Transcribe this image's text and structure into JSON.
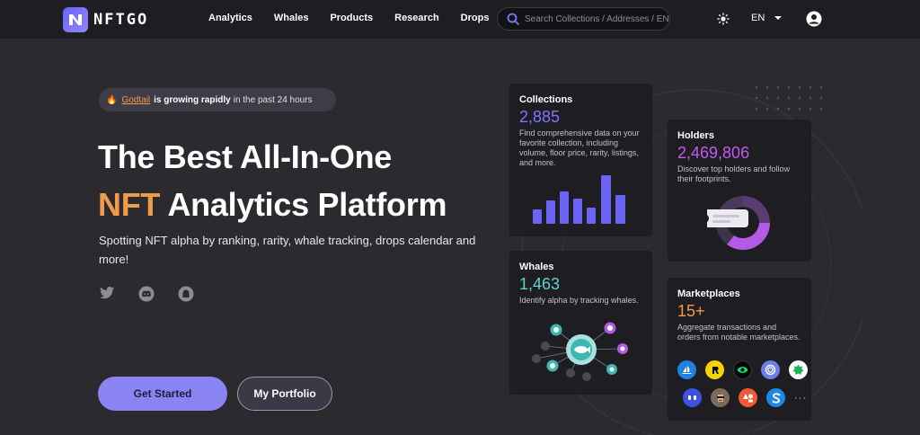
{
  "nav": {
    "logo_text": "NFTGO",
    "links": [
      "Analytics",
      "Whales",
      "Products",
      "Research",
      "Drops"
    ],
    "search_placeholder": "Search Collections / Addresses / ENS",
    "language": "EN"
  },
  "hero": {
    "badge": {
      "collection": "Godtail",
      "bold_text": "is growing rapidly",
      "rest_text": "in the past 24 hours"
    },
    "title_line1": "The Best All-In-One",
    "title_accent": "NFT",
    "title_line2_rest": " Analytics Platform",
    "subtitle": "Spotting NFT alpha by ranking, rarity, whale tracking, drops calendar and more!",
    "primary_button": "Get Started",
    "secondary_button": "My Portfolio",
    "social_icons": [
      "twitter-icon",
      "discord-icon",
      "ghost-icon"
    ]
  },
  "cards": {
    "collections": {
      "title": "Collections",
      "value": "2,885",
      "desc": "Find comprehensive data on your favorite collection, including volume, floor price, rarity, listings, and more."
    },
    "holders": {
      "title": "Holders",
      "value": "2,469,806",
      "desc": "Discover top holders and follow their footprints."
    },
    "whales": {
      "title": "Whales",
      "value": "1,463",
      "desc": "Identify alpha by tracking whales."
    },
    "marketplaces": {
      "title": "Marketplaces",
      "value": "15+",
      "desc": "Aggregate transactions and orders from notable marketplaces.",
      "more": "···"
    }
  },
  "colors": {
    "background": "#2b2a2f",
    "nav": "#1e1e22",
    "accent_orange": "#f09a4c",
    "accent_blue": "#7c76ff",
    "accent_purple": "#c15bf0",
    "accent_teal": "#5ed1d1",
    "primary_button": "#8a84f3"
  }
}
